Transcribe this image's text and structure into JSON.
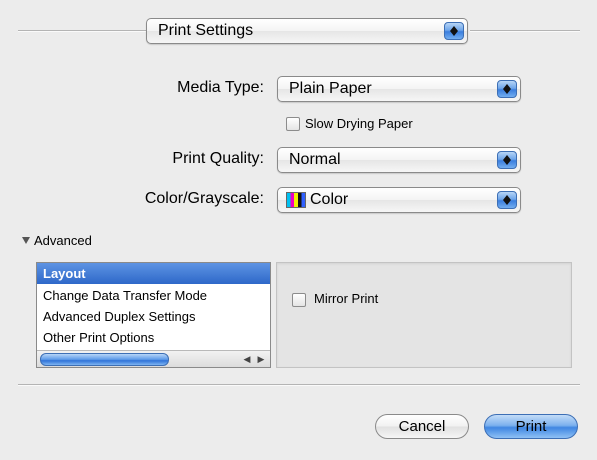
{
  "header": {
    "settings_popup_value": "Print Settings"
  },
  "form": {
    "media_type_label": "Media Type:",
    "media_type_value": "Plain Paper",
    "slow_drying_label": "Slow Drying Paper",
    "print_quality_label": "Print Quality:",
    "print_quality_value": "Normal",
    "color_label": "Color/Grayscale:",
    "color_value": "Color"
  },
  "advanced": {
    "label": "Advanced",
    "list_items": [
      "Layout",
      "Change Data Transfer Mode",
      "Advanced Duplex Settings",
      "Other Print Options"
    ],
    "selected_index": 0,
    "mirror_print_label": "Mirror Print"
  },
  "buttons": {
    "cancel": "Cancel",
    "print": "Print"
  },
  "icons": [
    "popup-arrows-icon",
    "color-swatch-icon",
    "disclosure-triangle-icon",
    "scroll-left-icon",
    "scroll-right-icon"
  ]
}
